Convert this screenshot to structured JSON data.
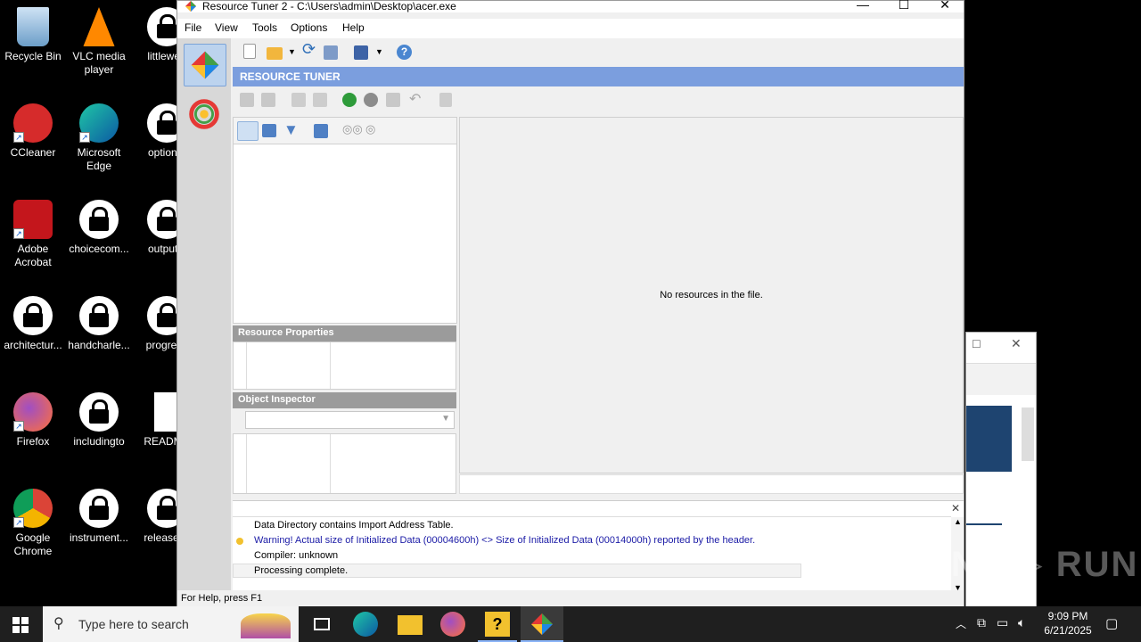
{
  "desktop": {
    "icons": [
      {
        "label": "Recycle Bin"
      },
      {
        "label": "VLC media player"
      },
      {
        "label": "littleweb"
      },
      {
        "label": "CCleaner"
      },
      {
        "label": "Microsoft Edge"
      },
      {
        "label": "optional"
      },
      {
        "label": "Adobe Acrobat"
      },
      {
        "label": "choicecom..."
      },
      {
        "label": "outputvi"
      },
      {
        "label": "architectur..."
      },
      {
        "label": "handcharle..."
      },
      {
        "label": "progress"
      },
      {
        "label": "Firefox"
      },
      {
        "label": "includingto"
      },
      {
        "label": "README"
      },
      {
        "label": "Google Chrome"
      },
      {
        "label": "instrument..."
      },
      {
        "label": "releasess"
      }
    ]
  },
  "window": {
    "title": "Resource Tuner 2 - C:\\Users\\admin\\Desktop\\acer.exe",
    "controls": {
      "minimize": "—",
      "maximize": "☐",
      "close": "✕"
    },
    "menu": [
      "File",
      "View",
      "Tools",
      "Options",
      "Help"
    ],
    "header": "RESOURCE TUNER",
    "main_message": "No resources in the file.",
    "resource_properties": "Resource Properties",
    "object_inspector": "Object Inspector",
    "log": [
      {
        "text": "Data Directory contains Import Address Table.",
        "warning": false
      },
      {
        "text": "Warning! Actual size of Initialized Data (00004600h) <> Size of Initialized Data (00014000h) reported by the header.",
        "warning": true
      },
      {
        "text": "Compiler: unknown",
        "warning": false
      },
      {
        "text": "Processing complete.",
        "warning": false
      }
    ],
    "log_close": "✕",
    "status": "For Help, press F1"
  },
  "taskbar": {
    "search_placeholder": "Type here to search",
    "time": "9:09 PM",
    "date": "6/21/2025"
  },
  "colors": {
    "header_bar": "#7b9ede",
    "warning_text": "#1a1aa6",
    "section_header": "#9b9b9b"
  }
}
